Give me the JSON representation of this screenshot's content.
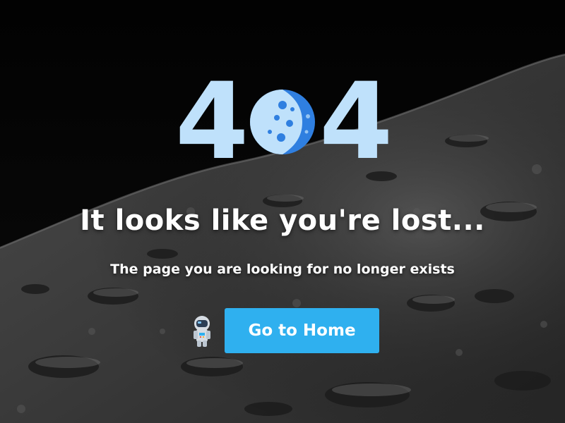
{
  "error": {
    "code_first_digit": "4",
    "code_last_digit": "4",
    "code_middle_icon": "moon-icon"
  },
  "message": {
    "headline": "It looks like you're lost...",
    "subline": "The page you are looking for no longer exists"
  },
  "actions": {
    "home_label": "Go to Home",
    "mascot_icon": "astronaut-icon"
  },
  "colors": {
    "digit": "#bfe1fb",
    "moon_light": "#bfe1fb",
    "moon_dark": "#2f7fe0",
    "button": "#2fb0ef",
    "text": "#ffffff"
  }
}
